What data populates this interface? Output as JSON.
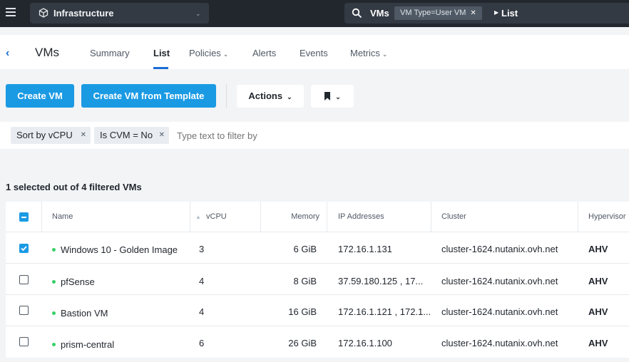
{
  "topbar": {
    "app_name": "Infrastructure",
    "search": {
      "entity": "VMs",
      "chip": "VM Type=User VM",
      "breadcrumb": "List"
    }
  },
  "nav": {
    "title": "VMs",
    "tabs": [
      {
        "label": "Summary"
      },
      {
        "label": "List"
      },
      {
        "label": "Policies"
      },
      {
        "label": "Alerts"
      },
      {
        "label": "Events"
      },
      {
        "label": "Metrics"
      }
    ],
    "active_tab": "List"
  },
  "actions": {
    "create_vm": "Create VM",
    "create_from_template": "Create VM from Template",
    "actions_menu": "Actions"
  },
  "filters": {
    "chips": [
      {
        "label": "Sort by vCPU"
      },
      {
        "label": "Is CVM = No"
      }
    ],
    "placeholder": "Type text to filter by"
  },
  "selection_summary": "1 selected out of 4 filtered VMs",
  "table": {
    "columns": [
      "Name",
      "vCPU",
      "Memory",
      "IP Addresses",
      "Cluster",
      "Hypervisor"
    ],
    "sorted_column": "vCPU",
    "rows": [
      {
        "selected": true,
        "status": "on",
        "name": "Windows 10 - Golden Image",
        "vcpu": "3",
        "memory": "6 GiB",
        "ip": "172.16.1.131",
        "cluster": "cluster-1624.nutanix.ovh.net",
        "hypervisor": "AHV"
      },
      {
        "selected": false,
        "status": "on",
        "name": "pfSense",
        "vcpu": "4",
        "memory": "8 GiB",
        "ip": "37.59.180.125 , 17...",
        "cluster": "cluster-1624.nutanix.ovh.net",
        "hypervisor": "AHV"
      },
      {
        "selected": false,
        "status": "on",
        "name": "Bastion VM",
        "vcpu": "4",
        "memory": "16 GiB",
        "ip": "172.16.1.121 , 172.1...",
        "cluster": "cluster-1624.nutanix.ovh.net",
        "hypervisor": "AHV"
      },
      {
        "selected": false,
        "status": "on",
        "name": "prism-central",
        "vcpu": "6",
        "memory": "26 GiB",
        "ip": "172.16.1.100",
        "cluster": "cluster-1624.nutanix.ovh.net",
        "hypervisor": "AHV"
      }
    ]
  },
  "colors": {
    "accent": "#1b9ae4",
    "link": "#1b6ed6",
    "status_on": "#36d068",
    "topbar_bg": "#22272e"
  }
}
